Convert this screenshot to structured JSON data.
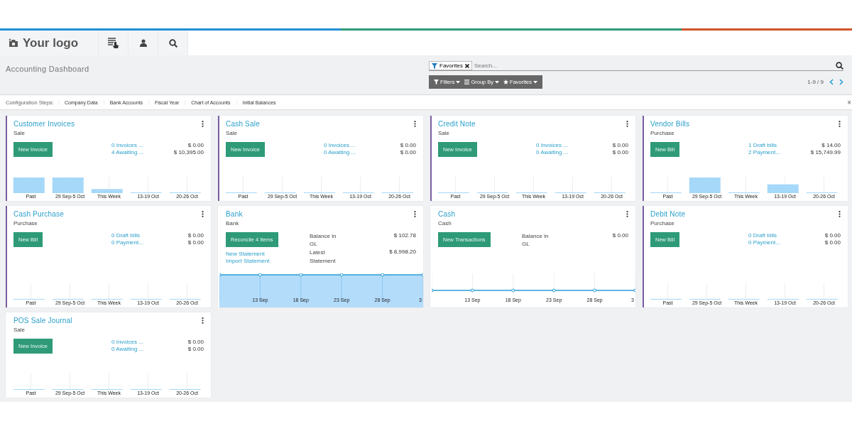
{
  "navbar": {
    "logo": "Your logo"
  },
  "control_panel": {
    "title": "Accounting Dashboard",
    "search": {
      "facet": "Favorites",
      "placeholder": "Search..."
    },
    "buttons": [
      "Filters",
      "Group By",
      "Favorites"
    ],
    "pager": "1-9 / 9"
  },
  "configuration_steps": {
    "label": "Configuration Steps:",
    "steps": [
      "Company Data",
      "Bank Accounts",
      "Fiscal Year",
      "Chart of Accounts",
      "Initial Balances"
    ],
    "close": "×"
  },
  "cards": [
    {
      "title": "Customer Invoices",
      "subtitle": "Sale",
      "accent": true,
      "button": "New Invoice",
      "stats": [
        {
          "label": "0 Invoices ...",
          "amount": "$ 0.00",
          "link": true
        },
        {
          "label": "4 Awaiting ...",
          "amount": "$ 10,395.00",
          "link": true
        }
      ],
      "chart": {
        "kind": "bars",
        "labels": [
          "Past",
          "29 Sep-5 Oct",
          "This Week",
          "13-19 Oct",
          "20-26 Oct"
        ]
      }
    },
    {
      "title": "Cash Sale",
      "subtitle": "Sale",
      "accent": true,
      "button": "New Invoice",
      "stats": [
        {
          "label": "0 Invoices ...",
          "amount": "$ 0.00",
          "link": true
        },
        {
          "label": "0 Awaiting ...",
          "amount": "$ 0.00",
          "link": true
        }
      ],
      "chart": {
        "kind": "bars",
        "labels": [
          "Past",
          "29 Sep-5 Oct",
          "This Week",
          "13-19 Oct",
          "20-26 Oct"
        ]
      }
    },
    {
      "title": "Credit Note",
      "subtitle": "Sale",
      "accent": true,
      "button": "New Invoice",
      "stats": [
        {
          "label": "0 Invoices ...",
          "amount": "$ 0.00",
          "link": true
        },
        {
          "label": "0 Awaiting ...",
          "amount": "$ 0.00",
          "link": true
        }
      ],
      "chart": {
        "kind": "bars",
        "labels": [
          "Past",
          "29 Sep-5 Oct",
          "This Week",
          "13-19 Oct",
          "20-26 Oct"
        ]
      }
    },
    {
      "title": "Vendor Bills",
      "subtitle": "Purchase",
      "accent": true,
      "button": "New Bill",
      "stats": [
        {
          "label": "1 Draft bills",
          "amount": "$ 14.00",
          "link": true
        },
        {
          "label": "2 Payment...",
          "amount": "$ 15,749.99",
          "link": true
        }
      ],
      "chart": {
        "kind": "bars",
        "labels": [
          "Past",
          "29 Sep-5 Oct",
          "This Week",
          "13-19 Oct",
          "20-26 Oct"
        ]
      }
    },
    {
      "title": "Cash Purchase",
      "subtitle": "Purchase",
      "accent": true,
      "button": "New Bill",
      "stats": [
        {
          "label": "0 Draft bills",
          "amount": "$ 0.00",
          "link": true
        },
        {
          "label": "0 Payment...",
          "amount": "$ 0.00",
          "link": true
        }
      ],
      "chart": {
        "kind": "bars",
        "labels": [
          "Past",
          "29 Sep-5 Oct",
          "This Week",
          "13-19 Oct",
          "20-26 Oct"
        ]
      }
    },
    {
      "title": "Bank",
      "subtitle": "Bank",
      "accent": false,
      "button": "Reconcile 4 Items",
      "actions": [
        "New Statement",
        "Import Statement"
      ],
      "stats": [
        {
          "label": "Balance in GL",
          "amount": "$ 102.78",
          "link": false
        },
        {
          "label": "Latest Statement",
          "amount": "$ 8,998.20",
          "link": false
        }
      ],
      "chart": {
        "kind": "area",
        "labels": [
          "13 Sep",
          "18 Sep",
          "23 Sep",
          "28 Sep",
          "3"
        ]
      }
    },
    {
      "title": "Cash",
      "subtitle": "Cash",
      "accent": false,
      "button": "New Transactions",
      "stats": [
        {
          "label": "Balance in GL",
          "amount": "$ 0.00",
          "link": false
        }
      ],
      "chart": {
        "kind": "line",
        "labels": [
          "13 Sep",
          "18 Sep",
          "23 Sep",
          "28 Sep",
          "3"
        ]
      }
    },
    {
      "title": "Debit Note",
      "subtitle": "Purchase",
      "accent": true,
      "button": "New Bill",
      "stats": [
        {
          "label": "0 Draft bills",
          "amount": "$ 0.00",
          "link": true
        },
        {
          "label": "0 Payment...",
          "amount": "$ 0.00",
          "link": true
        }
      ],
      "chart": {
        "kind": "bars",
        "labels": [
          "Past",
          "29 Sep-5 Oct",
          "This Week",
          "13-19 Oct",
          "20-26 Oct"
        ]
      }
    },
    {
      "title": "POS Sale Journal",
      "subtitle": "Sale",
      "accent": false,
      "button": "New Invoice",
      "stats": [
        {
          "label": "0 Invoices ...",
          "amount": "$ 0.00",
          "link": true
        },
        {
          "label": "0 Awaiting ...",
          "amount": "$ 0.00",
          "link": true
        }
      ],
      "chart": {
        "kind": "bars",
        "labels": [
          "Past",
          "29 Sep-5 Oct",
          "This Week",
          "13-19 Oct",
          "20-26 Oct"
        ]
      }
    }
  ]
}
